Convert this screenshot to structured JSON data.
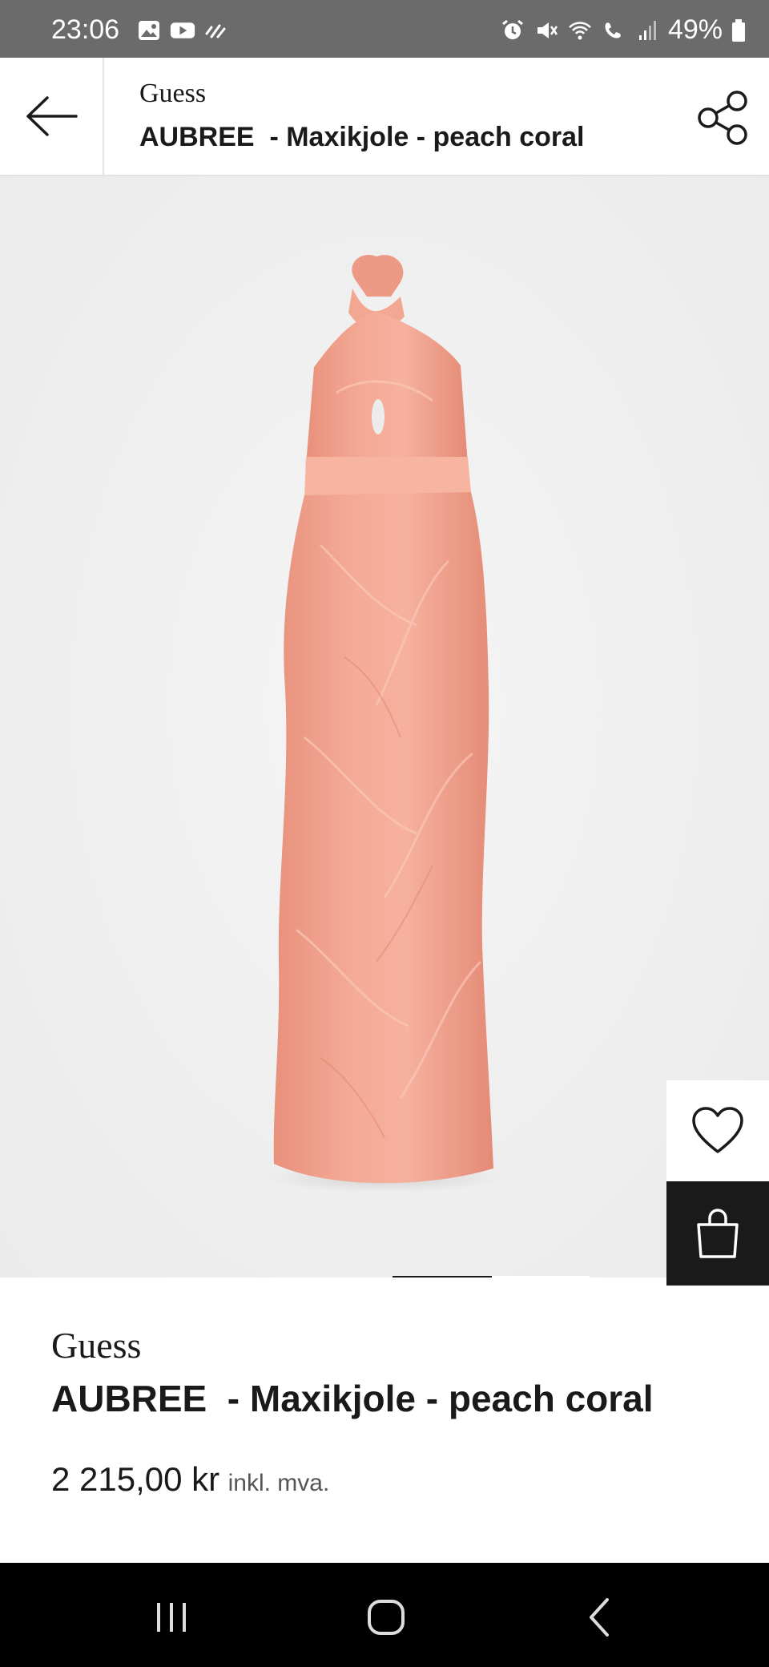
{
  "status_bar": {
    "time": "23:06",
    "battery": "49%",
    "left_icons": [
      "gallery-icon",
      "youtube-icon",
      "activity-icon"
    ],
    "right_icons": [
      "alarm-icon",
      "mute-icon",
      "wifi-icon",
      "wifi-call-icon",
      "signal-icon",
      "battery-icon"
    ]
  },
  "header": {
    "brand": "Guess",
    "title": "AUBREE  - Maxikjole - peach coral",
    "back_icon": "arrow-left-icon",
    "share_icon": "share-icon"
  },
  "product": {
    "brand": "Guess",
    "title": "AUBREE  - Maxikjole - peach coral",
    "price": "2 215,00 kr",
    "price_note": "inkl. mva.",
    "image_description_color": "#f0a38f",
    "image_pager": {
      "total": 2,
      "active": 1
    }
  },
  "actions": {
    "wishlist_icon": "heart-icon",
    "bag_icon": "shopping-bag-icon"
  },
  "nav_bar": {
    "icons": [
      "recent-apps-icon",
      "home-icon",
      "back-icon"
    ]
  }
}
